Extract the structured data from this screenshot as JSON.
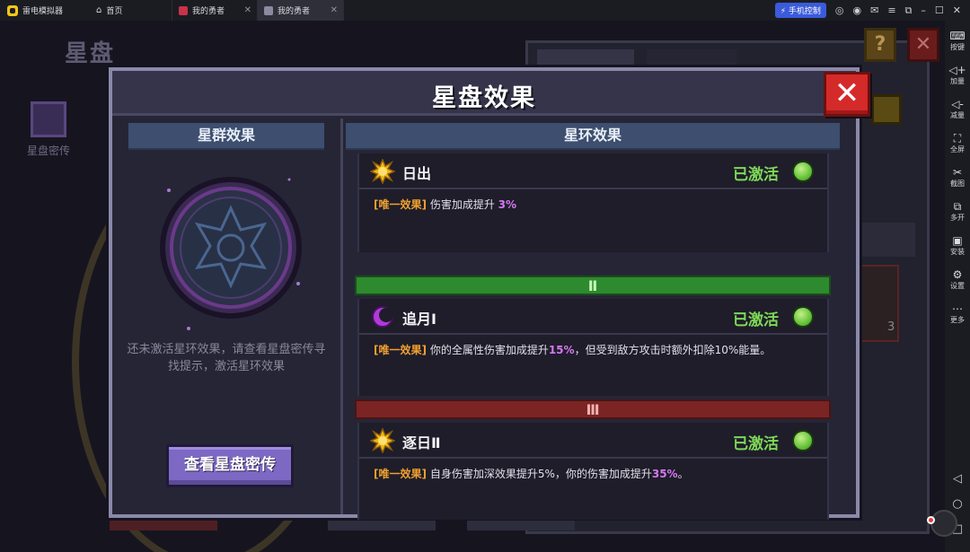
{
  "titlebar": {
    "app_name": "雷电模拟器",
    "tabs": [
      {
        "label": "首页"
      },
      {
        "label": "我的勇者"
      },
      {
        "label": "我的勇者"
      }
    ],
    "phone_control": "手机控制"
  },
  "background": {
    "title": "星盘",
    "side_item": "星盘密传",
    "help_mark": "?",
    "close_mark": "✕",
    "card_count": "3"
  },
  "modal": {
    "title": "星盘效果",
    "close": "✕",
    "left_header": "星群效果",
    "right_header": "星环效果",
    "hint": "还未激活星环效果，请查看星盘密传寻找提示，激活星环效果",
    "view_button": "查看星盘密传"
  },
  "rings": [
    {
      "name": "日出",
      "status": "已激活",
      "tag": "[唯一效果]",
      "text": "伤害加成提升",
      "value": "3%",
      "text2": ""
    },
    {
      "name": "追月Ⅰ",
      "status": "已激活",
      "tag": "[唯一效果]",
      "text": "你的全属性伤害加成提升",
      "value": "15%",
      "text2": "，但受到敌方攻击时额外扣除10%能量。"
    },
    {
      "name": "逐日Ⅱ",
      "status": "已激活",
      "tag": "[唯一效果]",
      "text": "自身伤害加深效果提升5%，你的伤害加成提升",
      "value": "35%",
      "text2": "。"
    }
  ],
  "tiers": [
    "Ⅱ",
    "Ⅲ"
  ],
  "sidebar": [
    {
      "label": "按键",
      "icon": "keyboard-icon"
    },
    {
      "label": "加量",
      "icon": "volume-up-icon"
    },
    {
      "label": "减量",
      "icon": "volume-down-icon"
    },
    {
      "label": "全屏",
      "icon": "fullscreen-icon"
    },
    {
      "label": "截图",
      "icon": "scissors-icon"
    },
    {
      "label": "多开",
      "icon": "multi-instance-icon"
    },
    {
      "label": "安装",
      "icon": "apk-install-icon"
    },
    {
      "label": "设置",
      "icon": "gear-icon"
    },
    {
      "label": "更多",
      "icon": "more-icon"
    }
  ],
  "colors": {
    "active_status": "#7ed957",
    "tag": "#f0a030",
    "highlight": "#d678f0",
    "tier2": "#2e8a2e",
    "tier3": "#7a2424"
  }
}
